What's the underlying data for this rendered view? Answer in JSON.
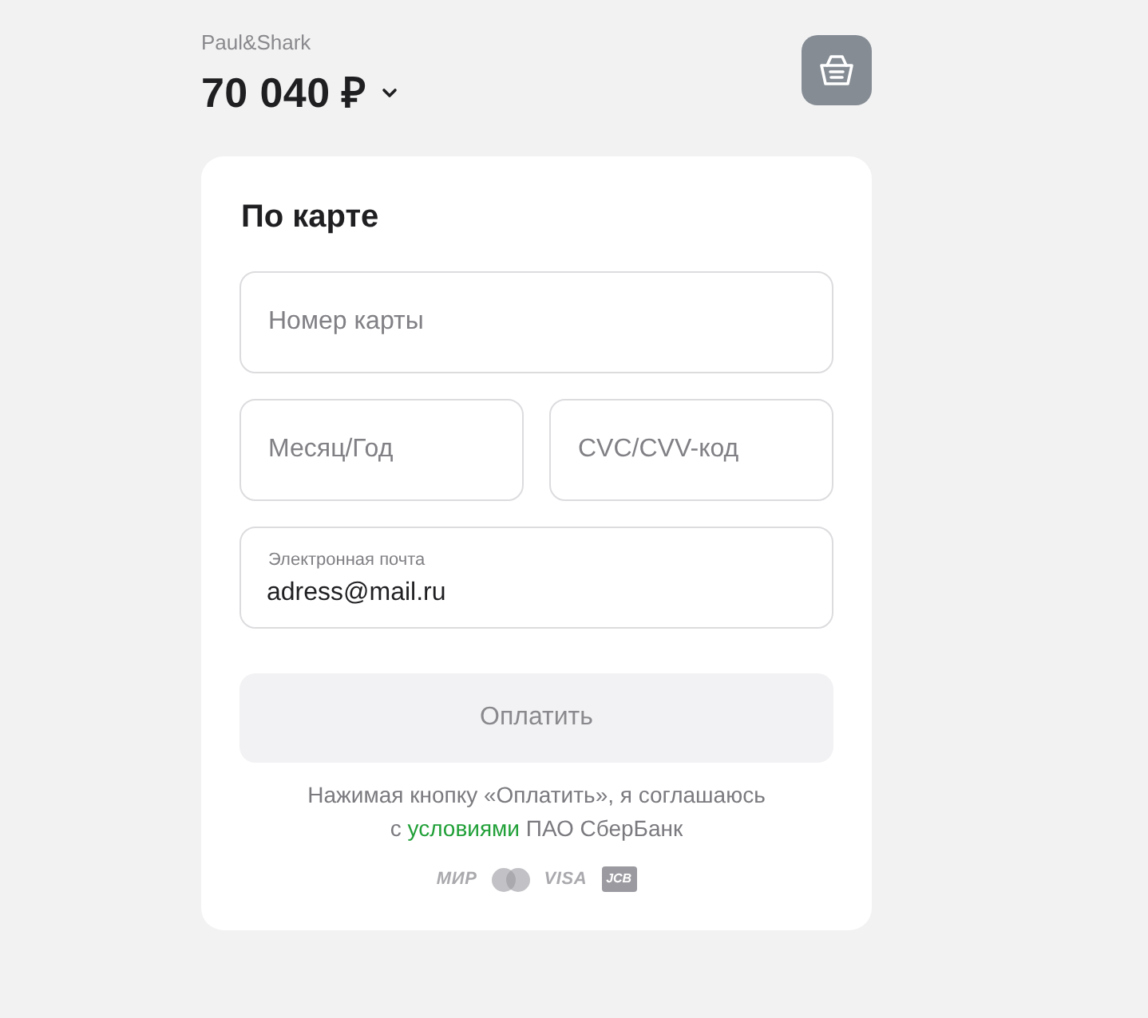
{
  "merchant": {
    "name": "Paul&Shark",
    "amount": "70 040 ₽",
    "expanded": false
  },
  "form": {
    "title": "По карте",
    "card_number": {
      "placeholder": "Номер карты"
    },
    "expiry": {
      "placeholder": "Месяц/Год"
    },
    "cvc": {
      "placeholder": "CVC/CVV-код"
    },
    "email": {
      "label": "Электронная почта",
      "value": "adress@mail.ru"
    }
  },
  "pay_button": {
    "label": "Оплатить",
    "disabled": true
  },
  "terms": {
    "first_line": "Нажимая кнопку «Оплатить», я соглашаюсь",
    "prefix": "с",
    "link": "условиями",
    "suffix": "ПАО СберБанк"
  },
  "payment_logos": [
    {
      "kind": "wordmark",
      "label": "МИР"
    },
    {
      "kind": "circles"
    },
    {
      "kind": "wordmark",
      "label": "VISA"
    },
    {
      "kind": "tile",
      "label": "JCB"
    }
  ]
}
